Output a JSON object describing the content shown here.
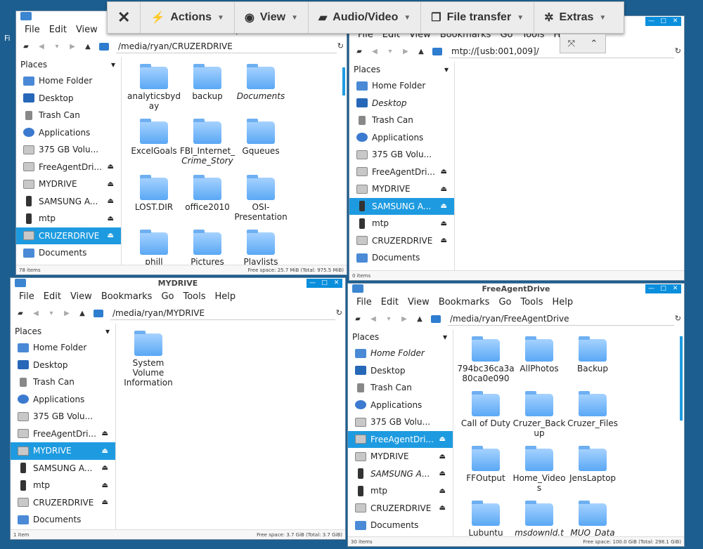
{
  "overlay": {
    "close_glyph": "✕",
    "actions_label": "Actions",
    "view_label": "View",
    "av_label": "Audio/Video",
    "transfer_label": "File transfer",
    "extras_label": "Extras"
  },
  "menu": [
    "File",
    "Edit",
    "View",
    "Bookmarks",
    "Go",
    "Tools",
    "Help"
  ],
  "sidebar_header": "Places",
  "win_tl": {
    "title": "",
    "path": "/media/ryan/CRUZERDRIVE",
    "places": [
      "Home Folder",
      "Desktop",
      "Trash Can",
      "Applications",
      "375 GB Volu...",
      "FreeAgentDri...",
      "MYDRIVE",
      "SAMSUNG A...",
      "mtp",
      "CRUZERDRIVE",
      "Documents"
    ],
    "files": [
      [
        "analyticsbyd",
        "ay"
      ],
      [
        "backup"
      ],
      [
        "Documents"
      ],
      [
        "ExcelGoals"
      ],
      [
        "FBI_Internet_",
        "Crime_Story"
      ],
      [
        "Gqueues"
      ],
      [
        "LOST.DIR"
      ],
      [
        "office2010"
      ],
      [
        "OSI-",
        "Presentation"
      ],
      [
        "phill"
      ],
      [
        "Pictures"
      ],
      [
        "Playlists"
      ]
    ],
    "status_left": "78 items",
    "status_right": "Free space: 25.7 MiB (Total: 975.5 MiB)"
  },
  "win_tr": {
    "path": "mtp://[usb:001,009]/",
    "places": [
      "Home Folder",
      "Desktop",
      "Trash Can",
      "Applications",
      "375 GB Volu...",
      "FreeAgentDri...",
      "MYDRIVE",
      "SAMSUNG A...",
      "mtp",
      "CRUZERDRIVE",
      "Documents"
    ],
    "status_left": "0 items",
    "status_right": ""
  },
  "win_bl": {
    "title": "MYDRIVE",
    "path": "/media/ryan/MYDRIVE",
    "places": [
      "Home Folder",
      "Desktop",
      "Trash Can",
      "Applications",
      "375 GB Volu...",
      "FreeAgentDri...",
      "MYDRIVE",
      "SAMSUNG A...",
      "mtp",
      "CRUZERDRIVE",
      "Documents"
    ],
    "files": [
      [
        "System",
        "Volume",
        "Information"
      ]
    ],
    "status_left": "1 item",
    "status_right": "Free space: 3.7 GiB (Total: 3.7 GiB)"
  },
  "win_br": {
    "title": "FreeAgentDrive",
    "path": "/media/ryan/FreeAgentDrive",
    "places": [
      "Home Folder",
      "Desktop",
      "Trash Can",
      "Applications",
      "375 GB Volu...",
      "FreeAgentDri...",
      "MYDRIVE",
      "SAMSUNG A...",
      "mtp",
      "CRUZERDRIVE",
      "Documents"
    ],
    "files": [
      [
        "794bc36ca3a",
        "80ca0e090"
      ],
      [
        "AllPhotos"
      ],
      [
        "Backup"
      ],
      [
        "Call of Duty"
      ],
      [
        "Cruzer_Back",
        "up"
      ],
      [
        "Cruzer_Files"
      ],
      [
        "FFOutput"
      ],
      [
        "Home_Video",
        "s"
      ],
      [
        "JensLaptop"
      ],
      [
        "Lubuntu"
      ],
      [
        "msdownld.t"
      ],
      [
        "MUO_Data"
      ]
    ],
    "status_left": "30 items",
    "status_right": "Free space: 100.0 GiB (Total: 298.1 GiB)"
  }
}
